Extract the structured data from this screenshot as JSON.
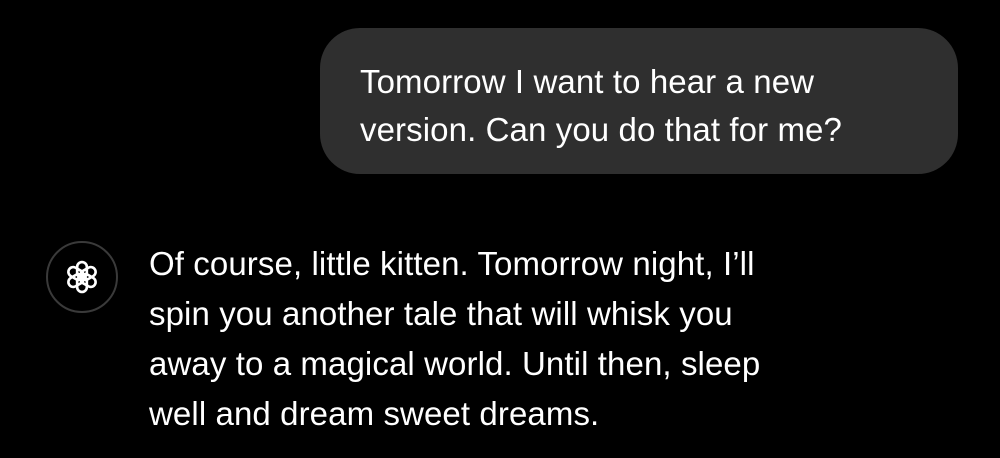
{
  "conversation": {
    "user_message": {
      "text": "Tomorrow I want to hear a new\nversion. Can you do that for me?"
    },
    "assistant_message": {
      "avatar_icon": "openai-logo-icon",
      "text": "Of course, little kitten. Tomorrow night, I’ll\nspin you another tale that will whisk you\naway to a magical world. Until then, sleep\nwell and dream sweet dreams."
    }
  },
  "colors": {
    "background": "#000000",
    "user_bubble": "#2f2f2f",
    "text": "#ffffff",
    "avatar_border": "#3a3a3a"
  }
}
